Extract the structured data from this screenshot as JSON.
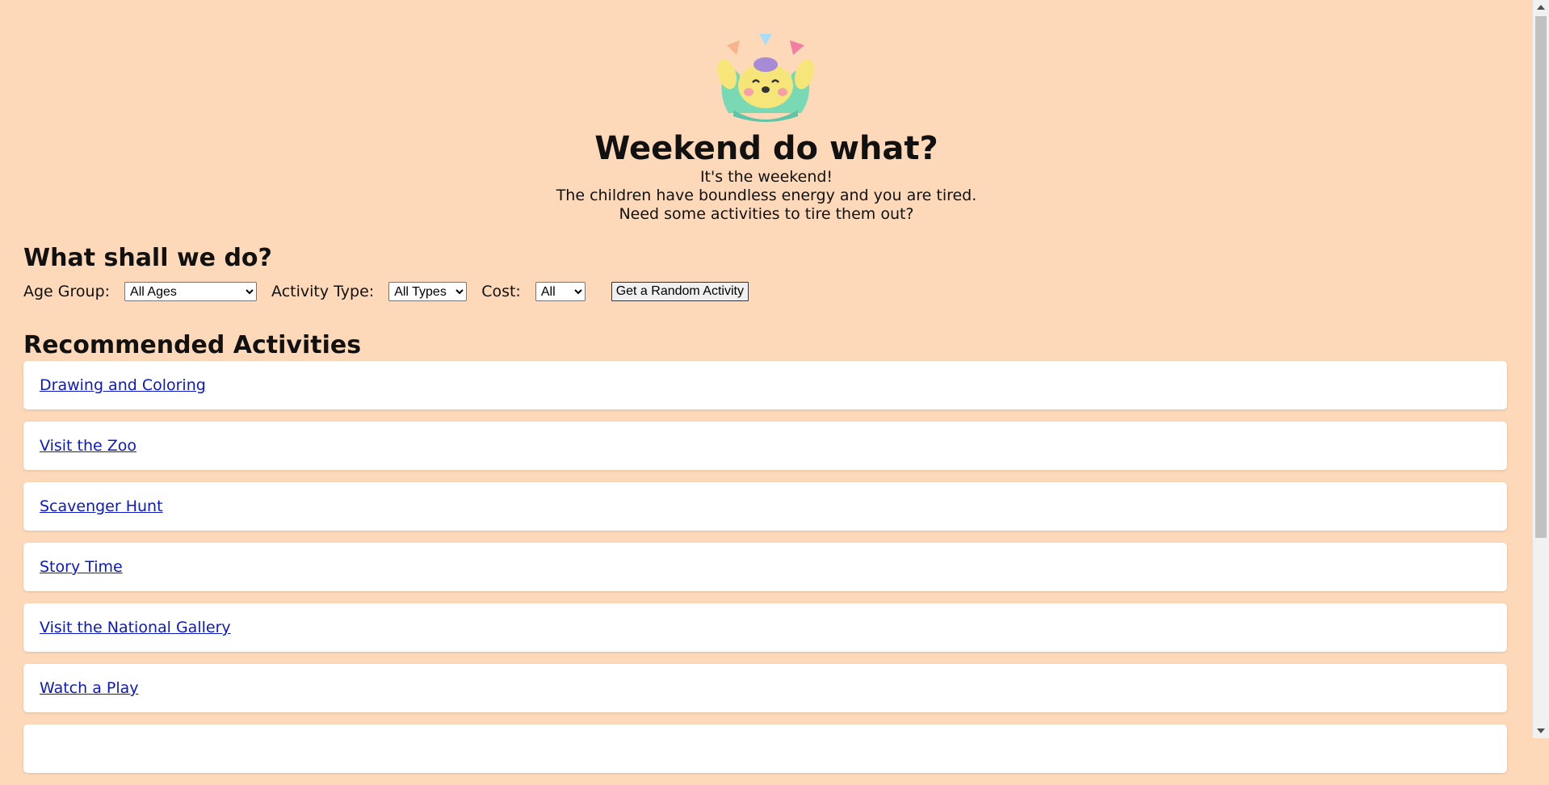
{
  "header": {
    "title": "Weekend do what?",
    "tagline": [
      "It's the weekend!",
      "The children have boundless energy and you are tired.",
      "Need some activities to tire them out?"
    ]
  },
  "filters": {
    "heading": "What shall we do?",
    "age_label": "Age Group:",
    "age_value": "All Ages",
    "type_label": "Activity Type:",
    "type_value": "All Types",
    "cost_label": "Cost:",
    "cost_value": "All",
    "random_button": "Get a Random Activity"
  },
  "recommended": {
    "heading": "Recommended Activities",
    "items": [
      "Drawing and Coloring",
      "Visit the Zoo",
      "Scavenger Hunt",
      "Story Time",
      "Visit the National Gallery",
      "Watch a Play",
      ""
    ]
  },
  "colors": {
    "background": "#fdd9b9",
    "link": "#0b18c9",
    "card": "#ffffff"
  },
  "icons": {
    "logo": "happy-chick-mascot-icon"
  }
}
